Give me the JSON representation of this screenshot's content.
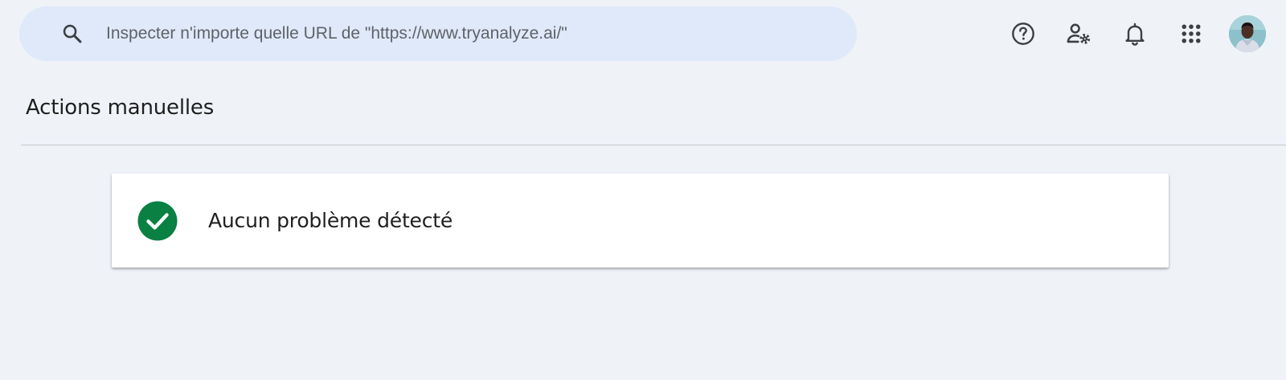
{
  "search": {
    "placeholder": "Inspecter n'importe quelle URL de \"https://www.tryanalyze.ai/\"",
    "icon": "search-icon"
  },
  "toolbar": {
    "icons": [
      "help-icon",
      "user-settings-icon",
      "notifications-icon",
      "apps-grid-icon"
    ],
    "avatar": "avatar"
  },
  "page": {
    "title": "Actions manuelles"
  },
  "status": {
    "message": "Aucun problème détecté",
    "icon": "check-circle-icon",
    "color": "#0b8043"
  }
}
